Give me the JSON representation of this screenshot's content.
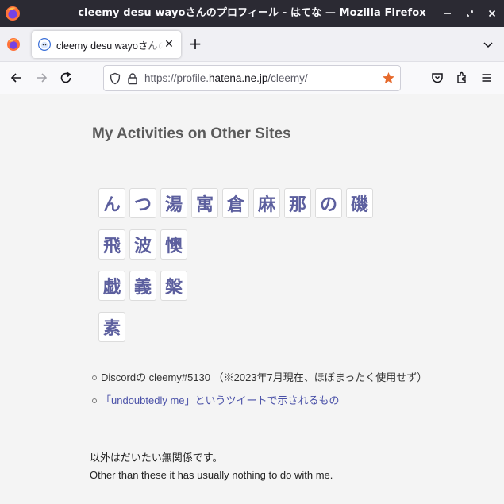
{
  "window": {
    "title": "cleemy desu wayoさんのプロフィール - はてな — Mozilla Firefox",
    "controls": [
      "minimize",
      "restore",
      "close"
    ]
  },
  "tabs": [
    {
      "label": "cleemy desu wayoさんのプロフィール - はてな",
      "active": true,
      "icon": "hatena-avatar-icon"
    }
  ],
  "toolbar": {
    "url_prefix": "https://profile.",
    "url_host": "hatena.ne.jp",
    "url_path": "/cleemy/",
    "bookmarked": true,
    "star_color": "#e66a2c"
  },
  "page": {
    "heading": "My Activities on Other Sites",
    "tile_rows": [
      [
        "ん",
        "つ",
        "湯",
        "寓",
        "倉",
        "麻",
        "那",
        "の",
        "磯"
      ],
      [
        "飛",
        "波",
        "懊"
      ],
      [
        "戯",
        "義",
        "槃"
      ],
      [
        "素"
      ]
    ],
    "tile_color": "#5c5f9e",
    "list_items": [
      {
        "text": "Discordの cleemy#5130 （※2023年7月現在、ほぼまったく使用せず）",
        "is_link": false
      },
      {
        "text": "「undoubtedly me」というツイートで示されるもの",
        "is_link": true
      }
    ],
    "note_ja": "以外はだいたい無関係です。",
    "note_en": "Other than these it has usually nothing to do with me."
  }
}
